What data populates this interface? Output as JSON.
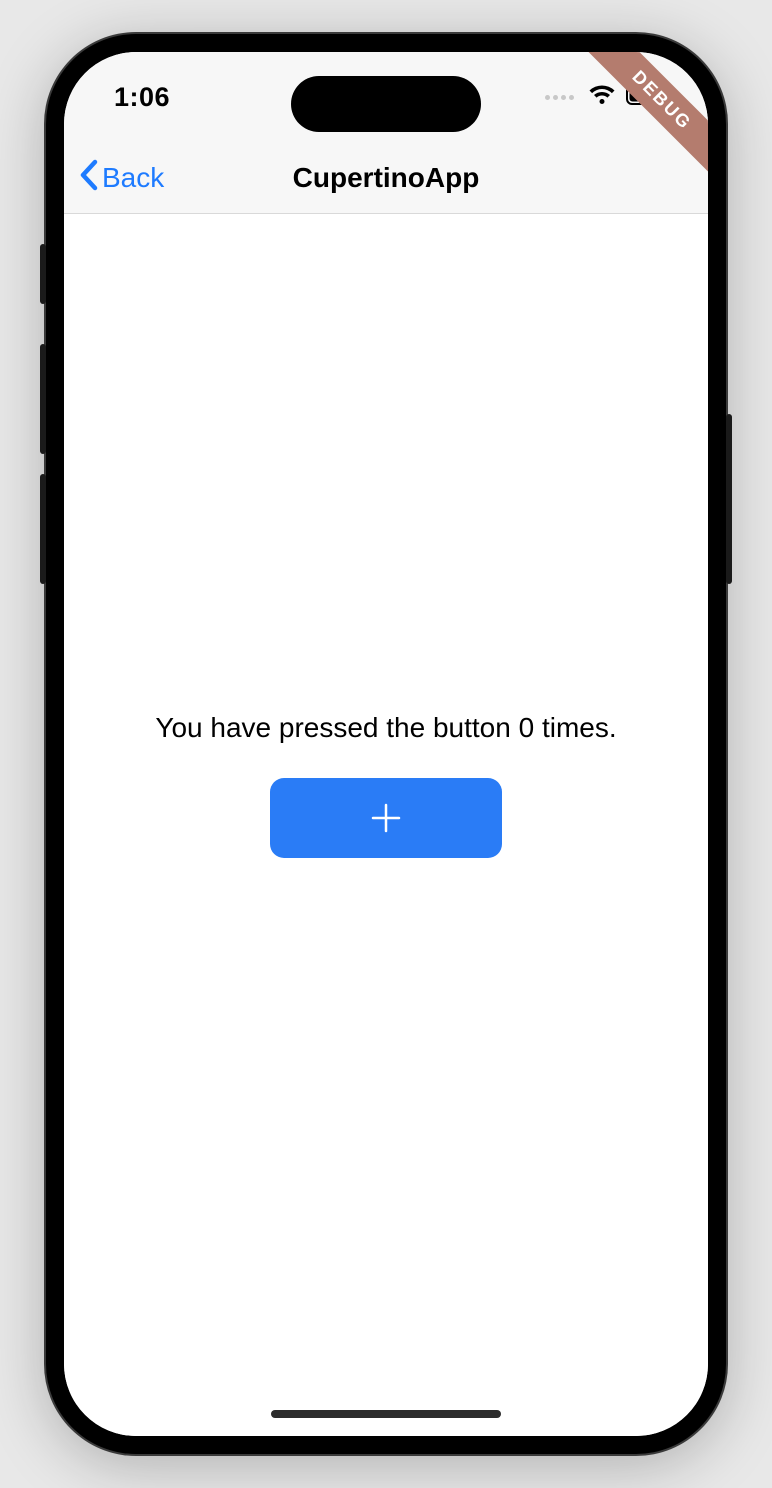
{
  "status": {
    "time": "1:06"
  },
  "nav": {
    "back_label": "Back",
    "title": "CupertinoApp"
  },
  "content": {
    "counter_text": "You have pressed the button 0 times.",
    "counter_value": 0
  },
  "debug_banner": "DEBUG",
  "colors": {
    "accent": "#2a7cf6",
    "link": "#1e7bff"
  }
}
